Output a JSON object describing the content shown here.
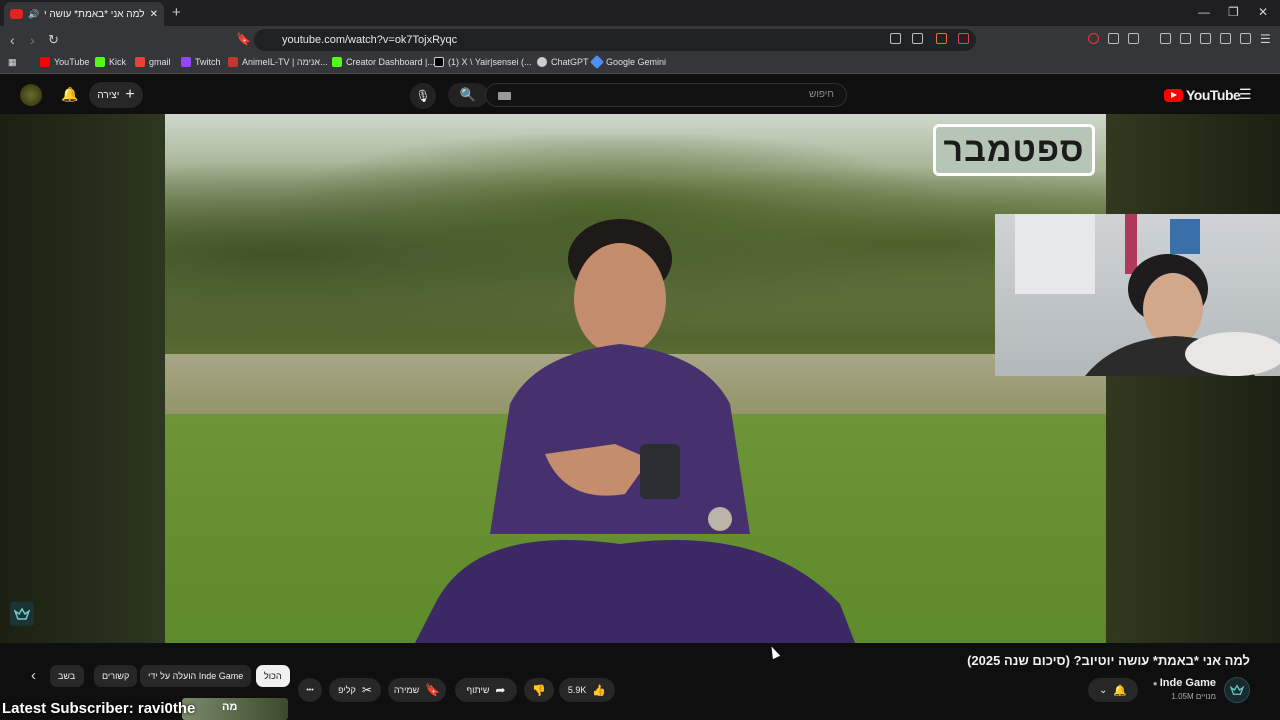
{
  "browser": {
    "tab_title": "למה אני *באמת* עושה יוטיוב?",
    "new_tab": "+",
    "url": "youtube.com/watch?v=ok7TojxRyqc",
    "window_min": "—",
    "window_restore": "❐",
    "window_close": "✕"
  },
  "bookmarks": [
    {
      "label": "YouTube",
      "color": "#ff0000"
    },
    {
      "label": "Kick",
      "color": "#53fc18"
    },
    {
      "label": "gmail",
      "color": "#ea4335"
    },
    {
      "label": "Twitch",
      "color": "#9146ff"
    },
    {
      "label": "AnimeIL-TV | אנימה...",
      "color": "#c0392b"
    },
    {
      "label": "Creator Dashboard |...",
      "color": "#53fc18"
    },
    {
      "label": "(1) X \\ Yair|sensei (...",
      "color": "#ffffff"
    },
    {
      "label": "ChatGPT",
      "color": "#cccccc"
    },
    {
      "label": "Google Gemini",
      "color": "#4f8df7"
    }
  ],
  "youtube": {
    "create_label": "יצירה",
    "search_placeholder": "חיפוש",
    "logo_text": "YouTube"
  },
  "video": {
    "overlay_badge": "ספטמבר",
    "title": "למה אני *באמת* עושה יוטיוב? (סיכום שנה 2025)"
  },
  "chips": {
    "all": "הכול",
    "uploaded_by": "הועלה על ידי Inde Game",
    "related": "קשורים",
    "partial": "בשב"
  },
  "actions": {
    "likes": "5.9K",
    "share": "שיתוף",
    "save": "שמירה",
    "clip": "קליפ",
    "more": "•••"
  },
  "channel": {
    "name": "Inde Game",
    "subscribers": "1.05M מנויים"
  },
  "stream_overlay": {
    "latest_subscriber": "Latest Subscriber: ravi0the",
    "thumb_text": "מה"
  }
}
